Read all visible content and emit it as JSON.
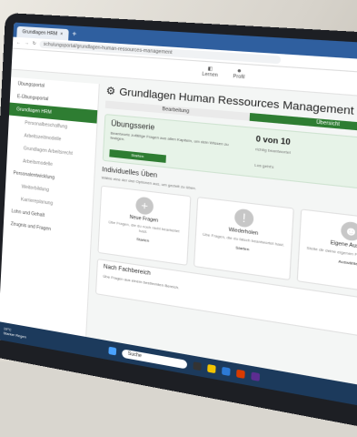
{
  "browser": {
    "tab_title": "Grundlagen HRM",
    "url": "schulungsportal/grundlagen-human-ressources-management"
  },
  "toolbar": {
    "item1": "Lernen",
    "item2": "Profil"
  },
  "sidebar": {
    "items": [
      {
        "label": "Übungsportal"
      },
      {
        "label": "E-Übungsportal"
      },
      {
        "label": "Grundlagen HRM"
      },
      {
        "label": "Personalbeschaffung"
      },
      {
        "label": "Arbeitszeitmodelle"
      },
      {
        "label": "Grundlagen Arbeitsrecht"
      },
      {
        "label": "Arbeitsmodelle"
      },
      {
        "label": "Personalentwicklung"
      },
      {
        "label": "Weiterbildung"
      },
      {
        "label": "Karriereplanung"
      },
      {
        "label": "Lohn und Gehalt"
      },
      {
        "label": "Zeugnis und Fragen"
      }
    ]
  },
  "main": {
    "title": "Grundlagen Human Ressources Management (HRM)",
    "tabs": [
      "Bearbeitung",
      "Übersicht"
    ],
    "uebung": {
      "title": "Übungsserie",
      "desc": "Beantworte zufällige Fragen aus allen Kapiteln, um dein Wissen zu festigen.",
      "button": "Starten",
      "score": "0 von 10",
      "score_sub": "richtig beantwortet",
      "lets": "Los geht's"
    },
    "section_title": "Individuelles Üben",
    "section_desc": "Wähle eine der drei Optionen aus, um gezielt zu üben.",
    "options": [
      {
        "title": "Neue Fragen",
        "desc": "Übe Fragen, die du noch nicht bearbeitet hast.",
        "action": "Starten",
        "icon": "plus-icon"
      },
      {
        "title": "Wiederholen",
        "desc": "Übe Fragen, die du falsch beantwortet hast.",
        "action": "Starten",
        "icon": "exclamation-icon"
      },
      {
        "title": "Eigene Auswahl",
        "desc": "Stelle dir deine eigenen Fragen zusammen.",
        "action": "Auswählen",
        "icon": "person-icon"
      }
    ],
    "nach": {
      "title": "Nach Fachbereich",
      "desc": "Übe Fragen aus einem bestimmten Bereich."
    }
  },
  "taskbar": {
    "search": "Suche",
    "weather_temp": "19°C",
    "weather_text": "Starker Regen"
  }
}
